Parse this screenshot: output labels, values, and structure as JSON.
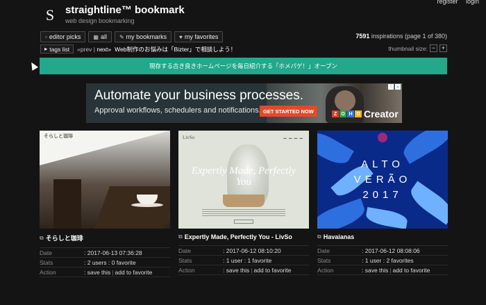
{
  "header": {
    "logo_letter": "S",
    "title": "straightline™ bookmark",
    "subtitle": "web design bookmarking",
    "register": "register",
    "login": "login"
  },
  "filters": [
    {
      "icon": "rss-icon",
      "label": "editor picks"
    },
    {
      "icon": "grid-icon",
      "label": "all"
    },
    {
      "icon": "pencil-icon",
      "label": "my bookmarks"
    },
    {
      "icon": "heart-icon",
      "label": "my favorites"
    }
  ],
  "inspirations": {
    "count": "7591",
    "text": "inspirations (page 1 of 380)"
  },
  "tags_bar": {
    "tags_label": "tags list",
    "prev": "«prev",
    "sep": "|",
    "next": "next»",
    "message": "Web制作のお悩みは「Bizter」で相談しよう！",
    "thumbnail_size": "thumbnail size:",
    "minus": "−",
    "plus": "+"
  },
  "banner": {
    "text": "現存する古き良きホームページを毎日紹介する「ホメパゲ！」オープン",
    "color": "#22a88a"
  },
  "ad": {
    "headline": "Automate your business processes.",
    "text": "Approval workflows, schedulers and notifications.",
    "cta": "GET STARTED NOW",
    "brand_letters": [
      "Z",
      "O",
      "H",
      "O"
    ],
    "brand_colors": [
      "#e23a2a",
      "#2aa64a",
      "#2a7ae0",
      "#f2b21a"
    ],
    "product": "Creator"
  },
  "cards": [
    {
      "title": "そらしと珈琲",
      "thumb_brand": "そらしと珈琲",
      "date_label": "Date",
      "date": "2017-06-13 07:36:28",
      "stats_label": "Stats",
      "stats": "2 users : 0 favorite",
      "action_label": "Action",
      "save": "save this",
      "fav": "add to favorite"
    },
    {
      "title": "Expertly Made, Perfectly You - LivSo",
      "thumb_brand": "LivSo",
      "thumb_headline": "Expertly Made, Perfectly You",
      "date_label": "Date",
      "date": "2017-06-12 08:10:20",
      "stats_label": "Stats",
      "stats": "1 user : 1 favorite",
      "action_label": "Action",
      "save": "save this",
      "fav": "add to favorite"
    },
    {
      "title": "Havaianas",
      "thumb_line1": "ALTO",
      "thumb_line2": "VERÃO",
      "thumb_line3": "2017",
      "date_label": "Date",
      "date": "2017-06-12 08:08:06",
      "stats_label": "Stats",
      "stats": "1 user : 2 favorites",
      "action_label": "Action",
      "save": "save this",
      "fav": "add to favorite"
    }
  ]
}
